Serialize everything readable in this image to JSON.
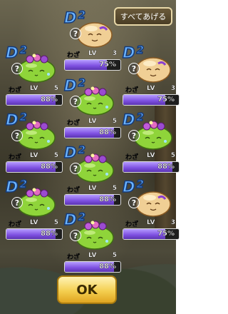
{
  "top_button": "すべてあげる",
  "ok_button": "OK",
  "cards": [
    {
      "kind": "tan",
      "rank": "D",
      "rank_num": "2",
      "waza": "わざ",
      "lv_label": "LV",
      "lv": "3",
      "progress": 75,
      "pct": "75%"
    },
    {
      "kind": "green",
      "rank": "D",
      "rank_num": "2",
      "waza": "わざ",
      "lv_label": "LV",
      "lv": "5",
      "progress": 88,
      "pct": "88%"
    },
    {
      "kind": "tan",
      "rank": "D",
      "rank_num": "2",
      "waza": "わざ",
      "lv_label": "LV",
      "lv": "3",
      "progress": 75,
      "pct": "75%"
    },
    {
      "kind": "green",
      "rank": "D",
      "rank_num": "2",
      "waza": "わざ",
      "lv_label": "LV",
      "lv": "5",
      "progress": 88,
      "pct": "88%"
    },
    {
      "kind": "green",
      "rank": "D",
      "rank_num": "2",
      "waza": "わざ",
      "lv_label": "LV",
      "lv": "5",
      "progress": 88,
      "pct": "88%"
    },
    {
      "kind": "green",
      "rank": "D",
      "rank_num": "2",
      "waza": "わざ",
      "lv_label": "LV",
      "lv": "5",
      "progress": 88,
      "pct": "88%"
    },
    {
      "kind": "green",
      "rank": "D",
      "rank_num": "2",
      "waza": "わざ",
      "lv_label": "LV",
      "lv": "5",
      "progress": 88,
      "pct": "88%"
    },
    {
      "kind": "green",
      "rank": "D",
      "rank_num": "2",
      "waza": "わざ",
      "lv_label": "LV",
      "lv": "5",
      "progress": 88,
      "pct": "88%"
    },
    {
      "kind": "green",
      "rank": "D",
      "rank_num": "2",
      "waza": "わざ",
      "lv_label": "LV",
      "lv": "5",
      "progress": 88,
      "pct": "88%"
    },
    {
      "kind": "green",
      "rank": "D",
      "rank_num": "2",
      "waza": "わざ",
      "lv_label": "LV",
      "lv": "5",
      "progress": 88,
      "pct": "88%"
    },
    {
      "kind": "tan",
      "rank": "D",
      "rank_num": "2",
      "waza": "わざ",
      "lv_label": "LV",
      "lv": "3",
      "progress": 75,
      "pct": "75%"
    },
    {
      "kind": "green",
      "rank": "D",
      "rank_num": "2",
      "waza": "わざ",
      "lv_label": "LV",
      "lv": "5",
      "progress": 88,
      "pct": "88%"
    },
    {
      "kind": "green",
      "rank": "D",
      "rank_num": "2",
      "waza": "わざ",
      "lv_label": "LV",
      "lv": "5",
      "progress": 88,
      "pct": "88%"
    }
  ],
  "colors": {
    "bar_fill": "#7d4fe0",
    "rank_text": "#6bb4ff",
    "green_slime": "#8fd43a",
    "tan_creature": "#f0cf95"
  }
}
